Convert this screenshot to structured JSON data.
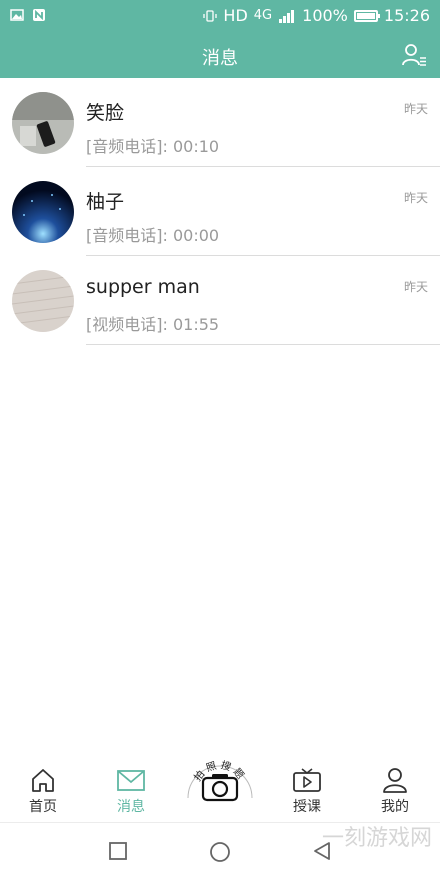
{
  "status_bar": {
    "network": "HD",
    "signal_type": "4G",
    "battery": "100%",
    "battery_level": 1.0,
    "time": "15:26"
  },
  "header": {
    "title": "消息",
    "contacts_icon": "contacts-icon"
  },
  "conversations": [
    {
      "name": "笑脸",
      "preview": "[音频电话]: 00:10",
      "time": "昨天",
      "avatar": "photo-desk"
    },
    {
      "name": "柚子",
      "preview": "[音频电话]: 00:00",
      "time": "昨天",
      "avatar": "photo-earth-night"
    },
    {
      "name": "supper man",
      "preview": "[视频电话]: 01:55",
      "time": "昨天",
      "avatar": "photo-paper"
    }
  ],
  "tab_bar": {
    "tabs": [
      {
        "label": "首页",
        "icon": "home-icon"
      },
      {
        "label": "消息",
        "icon": "mail-icon",
        "active": true
      },
      {
        "label": "授课",
        "icon": "tv-play-icon"
      },
      {
        "label": "我的",
        "icon": "user-icon"
      }
    ],
    "camera_caption": "拍照搜题",
    "accent": "#5fb7a3"
  },
  "watermark": "一刻游戏网"
}
